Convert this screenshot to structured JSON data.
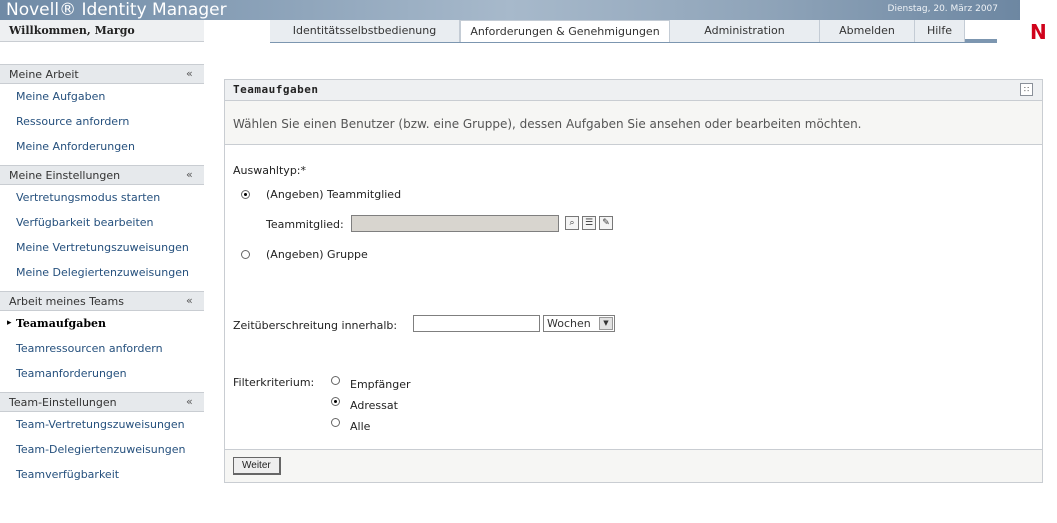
{
  "header": {
    "app_title": "Novell® Identity Manager",
    "date": "Dienstag, 20. März 2007",
    "logo_letter": "N",
    "welcome": "Willkommen, Margo"
  },
  "tabs": [
    {
      "label": "Identitätsselbstbedienung"
    },
    {
      "label": "Anforderungen & Genehmigungen",
      "active": true
    },
    {
      "label": "Administration"
    },
    {
      "label": "Abmelden"
    },
    {
      "label": "Hilfe"
    }
  ],
  "sidebar": {
    "sections": [
      {
        "title": "Meine Arbeit",
        "items": [
          "Meine Aufgaben",
          "Ressource anfordern",
          "Meine Anforderungen"
        ]
      },
      {
        "title": "Meine Einstellungen",
        "items": [
          "Vertretungsmodus starten",
          "Verfügbarkeit bearbeiten",
          "Meine Vertretungszuweisungen",
          "Meine Delegiertenzuweisungen"
        ]
      },
      {
        "title": "Arbeit meines Teams",
        "items": [
          "Teamaufgaben",
          "Teamressourcen anfordern",
          "Teamanforderungen"
        ],
        "active_item": "Teamaufgaben"
      },
      {
        "title": "Team-Einstellungen",
        "items": [
          "Team-Vertretungszuweisungen",
          "Team-Delegiertenzuweisungen",
          "Teamverfügbarkeit"
        ]
      }
    ]
  },
  "panel": {
    "title": "Teamaufgaben",
    "instruction": "Wählen Sie einen Benutzer (bzw. eine Gruppe), dessen Aufgaben Sie ansehen oder bearbeiten möchten.",
    "selection_type_label": "Auswahltyp:*",
    "option_member": "(Angeben) Teammitglied",
    "member_field_label": "Teammitglied:",
    "member_value": "",
    "option_group": "(Angeben) Gruppe",
    "timeout_label": "Zeitüberschreitung innerhalb:",
    "timeout_value": "",
    "timeout_unit": "Wochen",
    "filter_label": "Filterkriterium:",
    "filter_options": [
      "Empfänger",
      "Adressat",
      "Alle"
    ],
    "filter_selected": "Adressat",
    "submit_label": "Weiter"
  }
}
